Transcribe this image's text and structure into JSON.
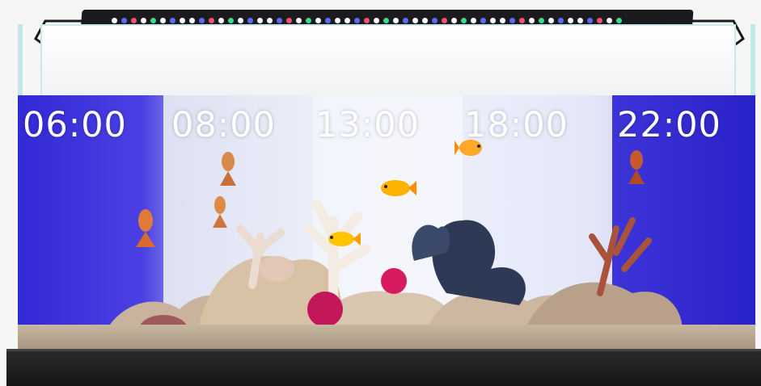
{
  "scene": {
    "time_labels": [
      {
        "text": "06:00"
      },
      {
        "text": "08:00"
      },
      {
        "text": "13:00"
      },
      {
        "text": "18:00"
      },
      {
        "text": "22:00"
      }
    ],
    "colors": {
      "night_blue": "#3a2fd9",
      "day_white": "#f1f3fb",
      "led_white": "#ffffff",
      "led_blue": "#5a6cff",
      "led_green": "#3ddc84",
      "led_red": "#ff4d6d",
      "coral_pink": "#d81b60",
      "fish_orange": "#ffb300"
    }
  }
}
